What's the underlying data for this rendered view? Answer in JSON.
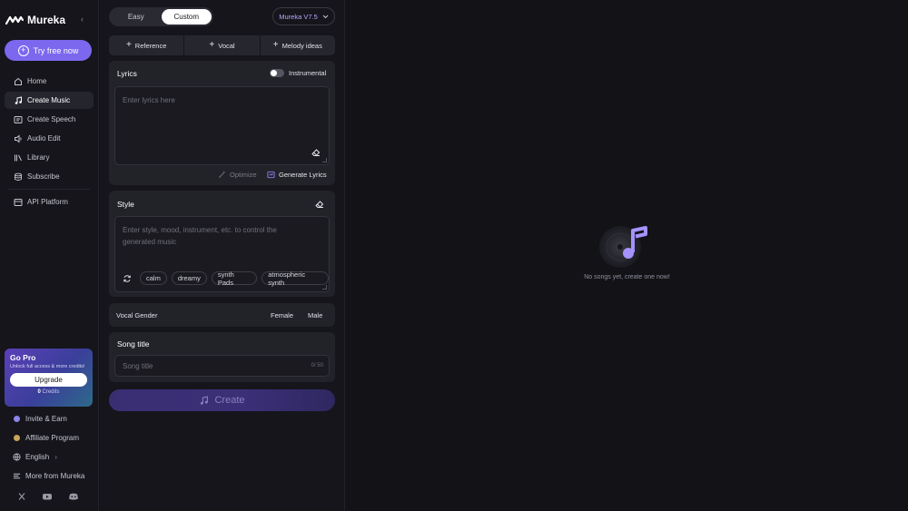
{
  "brand": {
    "name": "Mureka"
  },
  "sidebar": {
    "try_label": "Try free now",
    "items": [
      {
        "label": "Home",
        "icon": "home-icon"
      },
      {
        "label": "Create Music",
        "icon": "music-note-icon",
        "active": true
      },
      {
        "label": "Create Speech",
        "icon": "speech-icon"
      },
      {
        "label": "Audio Edit",
        "icon": "audio-edit-icon"
      },
      {
        "label": "Library",
        "icon": "library-icon"
      },
      {
        "label": "Subscribe",
        "icon": "subscribe-icon"
      },
      {
        "label": "API Platform",
        "icon": "api-icon"
      }
    ],
    "pro": {
      "title": "Go Pro",
      "subtitle": "Unlock full access & more credits!",
      "upgrade_label": "Upgrade",
      "credits_value": "0",
      "credits_label": "Credits"
    },
    "bottom": [
      {
        "label": "Invite & Earn",
        "icon": "invite-icon"
      },
      {
        "label": "Affiliate Program",
        "icon": "affiliate-icon"
      },
      {
        "label": "English",
        "icon": "globe-icon"
      },
      {
        "label": "More from Mureka",
        "icon": "menu-icon"
      }
    ],
    "language_chevron": "›",
    "socials": [
      "x-icon",
      "youtube-icon",
      "discord-icon"
    ]
  },
  "panel": {
    "modes": [
      "Easy",
      "Custom"
    ],
    "selected_mode": "Custom",
    "model": "Mureka V7.5",
    "add_options": [
      "Reference",
      "Vocal",
      "Melody ideas"
    ],
    "lyrics": {
      "title": "Lyrics",
      "instrumental_label": "Instrumental",
      "instrumental_on": false,
      "placeholder": "Enter lyrics here",
      "optimize_label": "Optimize",
      "generate_label": "Generate Lyrics"
    },
    "style": {
      "title": "Style",
      "placeholder_line1": "Enter style, mood, instrument, etc. to control the",
      "placeholder_line2": "generated music",
      "chips": [
        "calm",
        "dreamy",
        "synth Pads",
        "atmospheric synth"
      ]
    },
    "vocal_gender": {
      "label": "Vocal Gender",
      "options": [
        "Female",
        "Male"
      ]
    },
    "song_title": {
      "title": "Song title",
      "placeholder": "Song title",
      "counter": "0/ 50"
    },
    "create_label": "Create"
  },
  "main": {
    "empty_text": "No songs yet, create one now!"
  },
  "colors": {
    "accent": "#7b68ee",
    "background": "#121217",
    "panel": "#15151b",
    "card": "#222229"
  }
}
